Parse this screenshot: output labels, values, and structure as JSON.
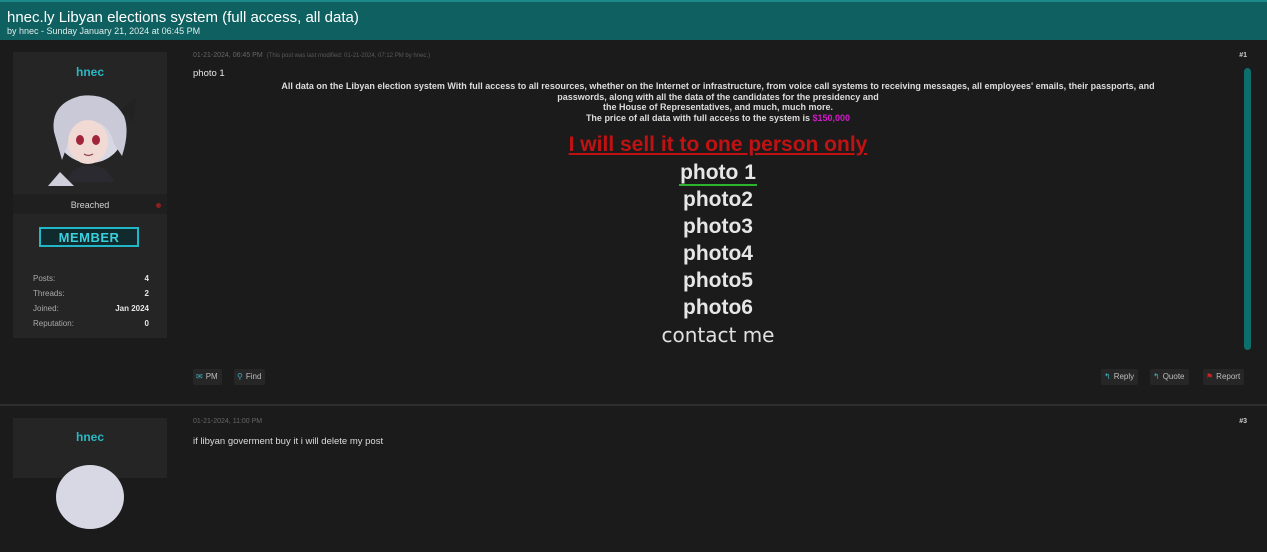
{
  "thread": {
    "title": "hnec.ly Libyan elections system (full access, all data)",
    "subtitle": "by hnec - Sunday January 21, 2024 at 06:45 PM"
  },
  "post1": {
    "author": "hnec",
    "status": "Breached",
    "rank": "MEMBER",
    "stats": [
      {
        "label": "Posts:",
        "value": "4"
      },
      {
        "label": "Threads:",
        "value": "2"
      },
      {
        "label": "Joined:",
        "value": "Jan 2024"
      },
      {
        "label": "Reputation:",
        "value": "0"
      }
    ],
    "date": "01-21-2024, 06:45 PM",
    "edited": "(This post was last modified: 01-21-2024, 07:12 PM by hnec.)",
    "number": "#1",
    "first_line": "photo 1",
    "paragraph_lines": [
      "All data on the Libyan election system With full access to all resources, whether on the Internet or infrastructure, from voice call systems to receiving messages, all employees' emails, their passports, and",
      "passwords, along with all the data of the candidates for the presidency and",
      "the House of Representatives, and much, much more."
    ],
    "price_prefix": "The price of all data with full access to the system is ",
    "price": "$150,000",
    "sell_line": "I will sell it to one person only",
    "photos": [
      "photo 1",
      "photo2",
      "photo3",
      "photo4",
      "photo5",
      "photo6"
    ],
    "contact": "contact me",
    "buttons": {
      "pm": "PM",
      "find": "Find",
      "reply": "Reply",
      "quote": "Quote",
      "report": "Report"
    }
  },
  "post2": {
    "author": "hnec",
    "date": "01-21-2024, 11:00 PM",
    "number": "#3",
    "text": "if libyan goverment buy it i will delete my post"
  },
  "colors": {
    "header_bg": "#0f6060",
    "username": "#2ab7c4",
    "price": "#d21ac9",
    "sell_red": "#c01212",
    "accent_teal": "#3fb0c0"
  },
  "icons": [
    "envelope-icon",
    "search-icon",
    "reply-icon",
    "quote-icon",
    "flag-icon"
  ]
}
